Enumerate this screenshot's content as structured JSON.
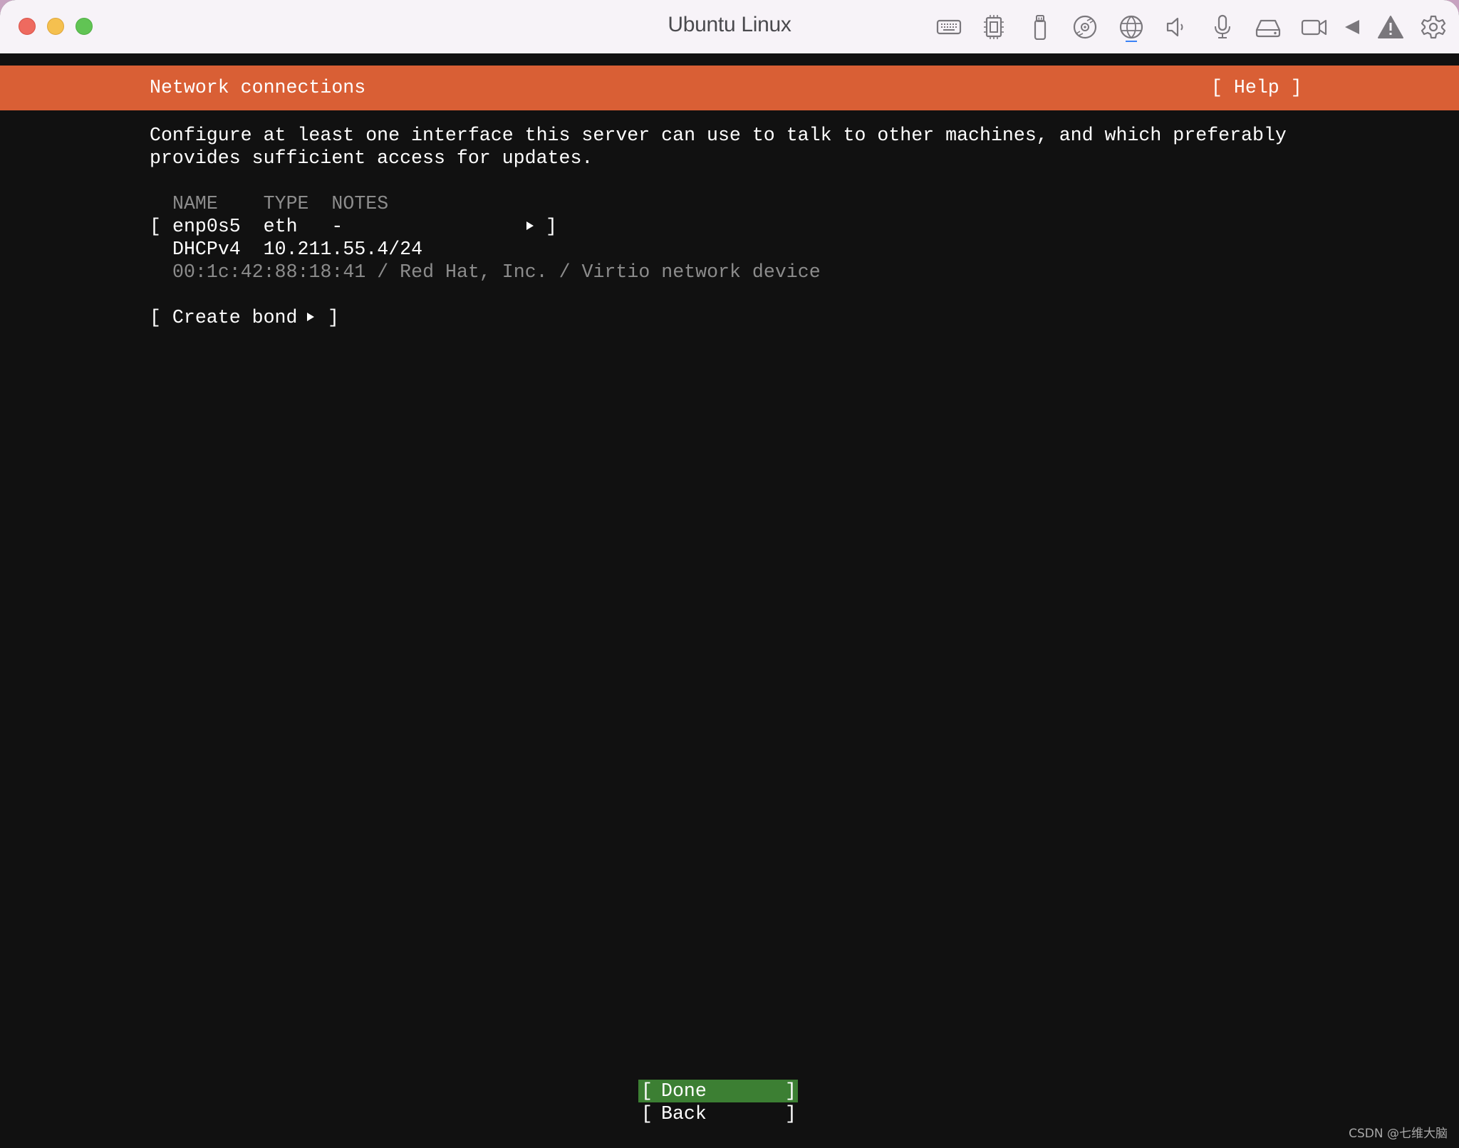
{
  "window": {
    "title": "Ubuntu Linux",
    "toolbar_icons": [
      "keyboard-icon",
      "cpu-icon",
      "usb-icon",
      "disc-icon",
      "network-globe-icon",
      "speaker-icon",
      "microphone-icon",
      "hard-disk-icon",
      "camera-icon",
      "play-icon",
      "warning-icon",
      "settings-gear-icon"
    ],
    "active_toolbar_icon": "network-globe-icon"
  },
  "header": {
    "title": "Network connections",
    "help_label": "[ Help ]"
  },
  "description": {
    "line1": "Configure at least one interface this server can use to talk to other machines, and which preferably",
    "line2": "provides sufficient access for updates."
  },
  "table": {
    "columns": [
      "NAME",
      "TYPE",
      "NOTES"
    ],
    "header_text": "NAME    TYPE  NOTES",
    "interfaces": [
      {
        "name": "enp0s5",
        "type": "eth",
        "notes": "-",
        "row_prefix": "[ ",
        "row_text": "enp0s5  eth   -",
        "row_suffix": "]",
        "address_text": "DHCPv4  10.211.55.4/24",
        "address_method": "DHCPv4",
        "address": "10.211.55.4/24",
        "mac": "00:1c:42:88:18:41",
        "vendor": "Red Hat, Inc.",
        "model": "Virtio network device",
        "detail_text": "00:1c:42:88:18:41 / Red Hat, Inc. / Virtio network device"
      }
    ]
  },
  "create_bond": {
    "prefix": "[ Create bond",
    "suffix": "]"
  },
  "buttons": {
    "done": {
      "open": "[",
      "label": "Done",
      "close": "]"
    },
    "back": {
      "open": "[",
      "label": "Back",
      "close": "]"
    }
  },
  "colors": {
    "header_orange": "#d95f35",
    "done_green": "#3c7f33",
    "terminal_bg": "#111111"
  },
  "watermark": "CSDN @七维大脑"
}
